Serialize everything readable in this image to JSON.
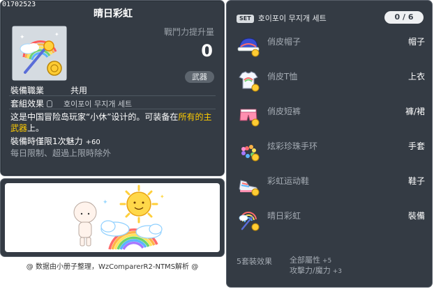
{
  "item": {
    "id": "01702523",
    "name": "晴日彩虹",
    "power_label": "戰鬥力提升量",
    "power_value": "0",
    "category": "武器",
    "job_label": "裝備職業",
    "job_value": "共用",
    "set_label": "套組效果",
    "set_name": "호이포이 무지개 세트",
    "desc_before": "这是中国冒险岛玩家“小休”设计的。可装备在",
    "desc_highlight": "所有的主武器",
    "desc_after": "上。",
    "charm_label": "裝備時僅限1次魅力",
    "charm_value": "+60",
    "limit_text": "每日限制、超過上限時除外"
  },
  "credit": "@ 数据由小册子整理，WzComparerR2-NTMS解析 @",
  "set_panel": {
    "badge": "SET",
    "title": "호이포이 무지개 세트",
    "count": "0 / 6",
    "pieces": [
      {
        "name": "俏皮帽子",
        "slot": "帽子",
        "icon": "hat-icon"
      },
      {
        "name": "俏皮T恤",
        "slot": "上衣",
        "icon": "tshirt-icon"
      },
      {
        "name": "俏皮短裤",
        "slot": "褲/裙",
        "icon": "shorts-icon"
      },
      {
        "name": "炫彩珍珠手环",
        "slot": "手套",
        "icon": "bracelet-icon"
      },
      {
        "name": "彩虹运动鞋",
        "slot": "鞋子",
        "icon": "sneaker-icon"
      },
      {
        "name": "晴日彩虹",
        "slot": "裝備",
        "icon": "rainbow-wand-icon"
      }
    ],
    "bonus_label": "5套裝效果",
    "bonus_lines": [
      {
        "stat": "全部屬性",
        "value": "+5"
      },
      {
        "stat": "攻擊力/魔力",
        "value": "+3"
      }
    ]
  },
  "colors": {
    "panel_bg": "#343b44",
    "highlight": "#ffcc00",
    "dim_text": "#a4abb3"
  }
}
